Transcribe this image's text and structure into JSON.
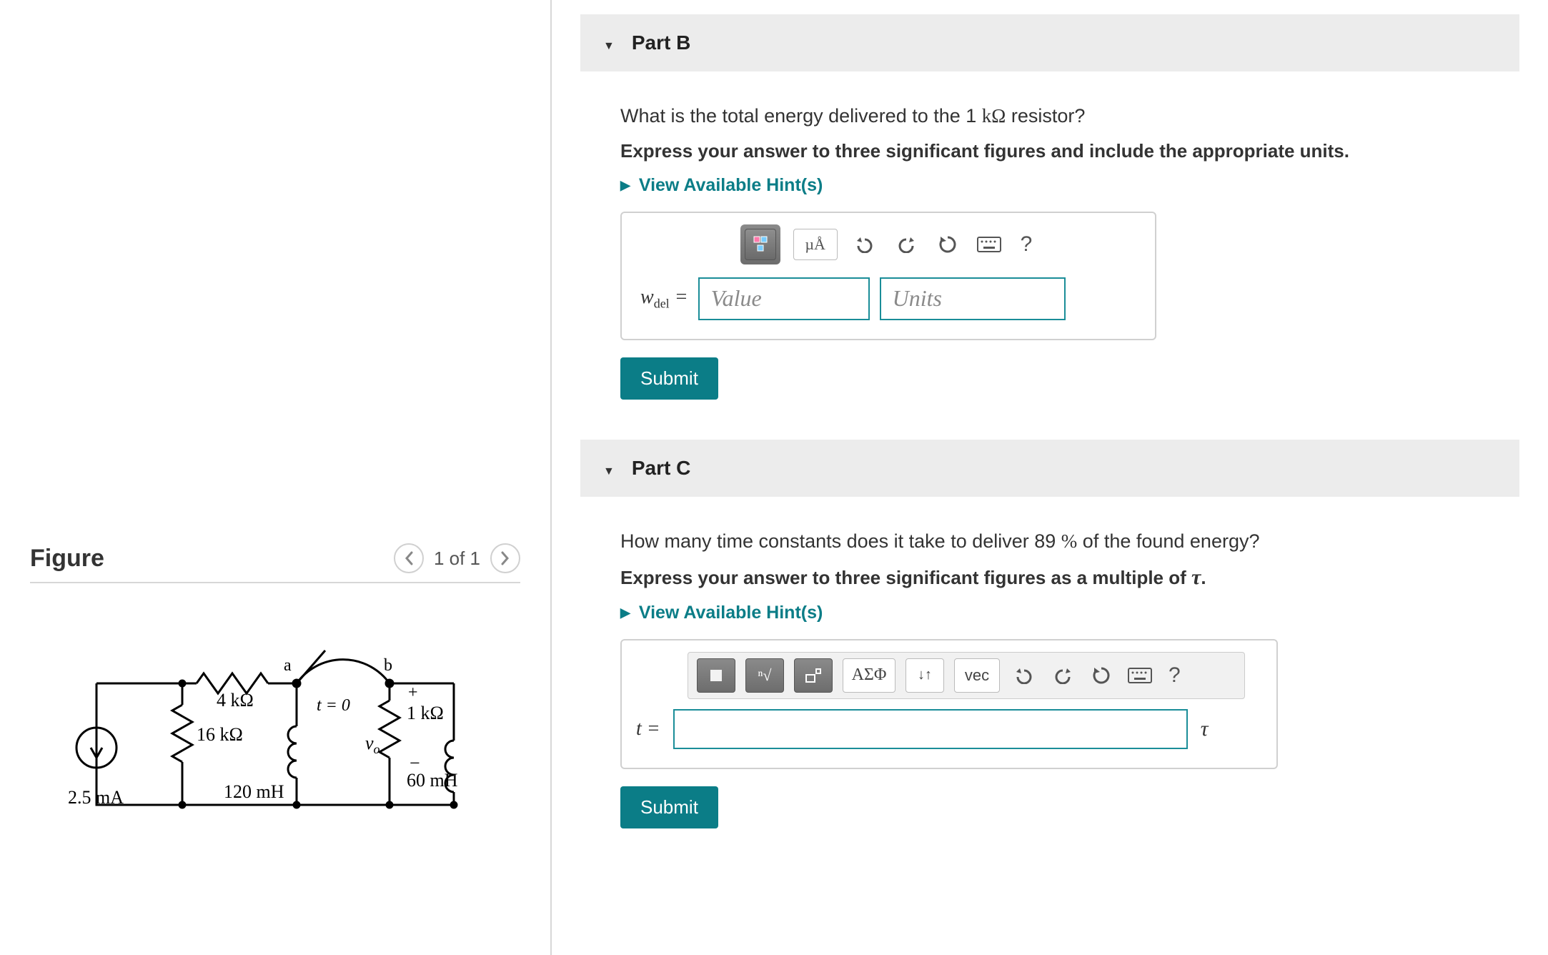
{
  "figure": {
    "title": "Figure",
    "nav_text": "1 of 1",
    "circuit": {
      "source_current": "2.5 mA",
      "r1": "4 kΩ",
      "r2": "16 kΩ",
      "l1": "120 mH",
      "switch_t": "t = 0",
      "node_a": "a",
      "node_b": "b",
      "r3": "1 kΩ",
      "l2": "60 mH",
      "vo_label": "v",
      "vo_sub": "o",
      "plus": "+",
      "minus": "−"
    }
  },
  "parts": {
    "b": {
      "header": "Part B",
      "question_pre": "What is the total energy delivered to the 1 ",
      "question_unit": "kΩ",
      "question_post": " resistor?",
      "instruct": "Express your answer to three significant figures and include the appropriate units.",
      "hints": "View Available Hint(s)",
      "variable": "w",
      "variable_sub": "del",
      "equals": " = ",
      "value_ph": "Value",
      "units_ph": "Units",
      "mu_a": "µÅ",
      "submit": "Submit"
    },
    "c": {
      "header": "Part C",
      "question_pre": "How many time constants does it take to deliver 89 ",
      "question_pct": "%",
      "question_post": " of the found energy?",
      "instruct_pre": "Express your answer to three significant figures as a multiple of ",
      "instruct_tau": "τ",
      "instruct_post": ".",
      "hints": "View Available Hint(s)",
      "variable": "t",
      "equals": " = ",
      "tau": "τ",
      "greek": "ΑΣΦ",
      "vec": "vec",
      "submit": "Submit"
    }
  }
}
